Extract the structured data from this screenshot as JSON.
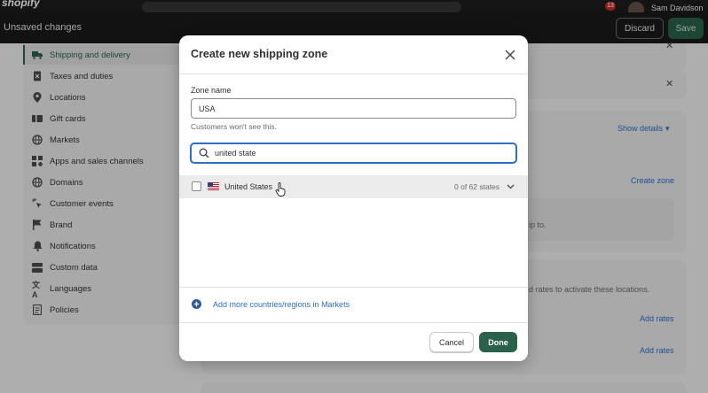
{
  "topbar": {
    "logo": "shopify",
    "notifications": "13",
    "user": "Sam Davidson"
  },
  "unsaved_bar": {
    "title": "Unsaved changes",
    "discard_label": "Discard",
    "save_label": "Save"
  },
  "sidebar": {
    "items": [
      {
        "label": "Shipping and delivery",
        "icon": "truck-icon",
        "active": true
      },
      {
        "label": "Taxes and duties",
        "icon": "receipt-icon"
      },
      {
        "label": "Locations",
        "icon": "location-icon"
      },
      {
        "label": "Gift cards",
        "icon": "gift-card-icon"
      },
      {
        "label": "Markets",
        "icon": "globe-icon"
      },
      {
        "label": "Apps and sales channels",
        "icon": "apps-icon"
      },
      {
        "label": "Domains",
        "icon": "domain-globe-icon"
      },
      {
        "label": "Customer events",
        "icon": "cursor-sparkle-icon"
      },
      {
        "label": "Brand",
        "icon": "brand-flag-icon"
      },
      {
        "label": "Notifications",
        "icon": "bell-icon"
      },
      {
        "label": "Custom data",
        "icon": "database-icon"
      },
      {
        "label": "Languages",
        "icon": "language-icon"
      },
      {
        "label": "Policies",
        "icon": "document-icon"
      }
    ]
  },
  "background": {
    "show_details": "Show details",
    "create_zone": "Create zone",
    "ship_to": "ip to.",
    "rates_text": "d rates to activate these locations.",
    "add_rates_1": "Add rates",
    "add_rates_2": "Add rates"
  },
  "modal": {
    "title": "Create new shipping zone",
    "zone_name_label": "Zone name",
    "zone_name_value": "USA",
    "zone_help": "Customers won't see this.",
    "search_value": "united state",
    "results": [
      {
        "country": "United States",
        "states": "0 of 62 states",
        "checked": false
      }
    ],
    "add_more_label": "Add more countries/regions in Markets",
    "cancel_label": "Cancel",
    "done_label": "Done"
  },
  "colors": {
    "primary": "#29614a",
    "link": "#2c6ecb",
    "topbar": "#1a1a1a"
  }
}
